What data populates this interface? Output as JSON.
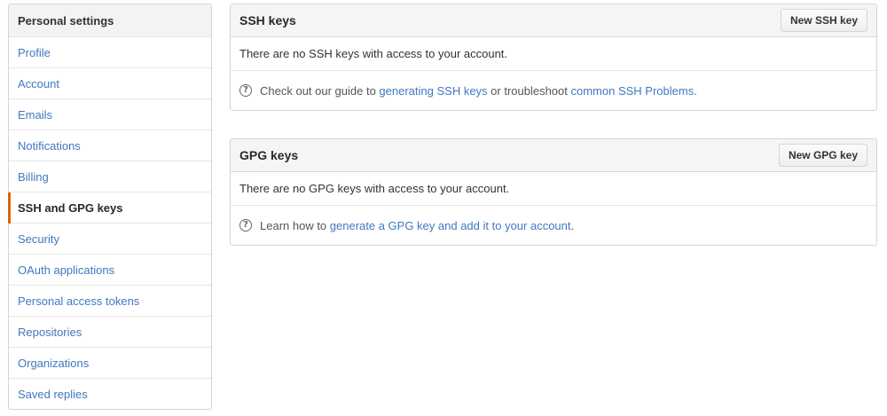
{
  "sidebar": {
    "header": "Personal settings",
    "items": [
      {
        "label": "Profile"
      },
      {
        "label": "Account"
      },
      {
        "label": "Emails"
      },
      {
        "label": "Notifications"
      },
      {
        "label": "Billing"
      },
      {
        "label": "SSH and GPG keys",
        "selected": true
      },
      {
        "label": "Security"
      },
      {
        "label": "OAuth applications"
      },
      {
        "label": "Personal access tokens"
      },
      {
        "label": "Repositories"
      },
      {
        "label": "Organizations"
      },
      {
        "label": "Saved replies"
      }
    ]
  },
  "ssh": {
    "title": "SSH keys",
    "new_button": "New SSH key",
    "empty_message": "There are no SSH keys with access to your account.",
    "help_prefix": "Check out our guide to ",
    "help_link1": "generating SSH keys",
    "help_middle": " or troubleshoot ",
    "help_link2": "common SSH Problems",
    "help_suffix": "."
  },
  "gpg": {
    "title": "GPG keys",
    "new_button": "New GPG key",
    "empty_message": "There are no GPG keys with access to your account.",
    "help_prefix": "Learn how to ",
    "help_link": "generate a GPG key and add it to your account",
    "help_suffix": "."
  },
  "icons": {
    "help": "question-circle-icon"
  },
  "colors": {
    "link": "#4078c0",
    "selected_indicator": "#d26911"
  }
}
